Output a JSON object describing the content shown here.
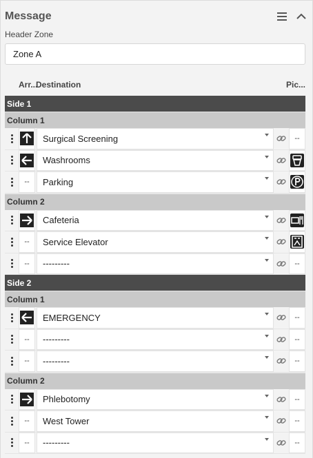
{
  "header": {
    "title": "Message"
  },
  "header_zone": {
    "label": "Header Zone",
    "value": "Zone A"
  },
  "columns": {
    "arrow": "Arr...",
    "destination": "Destination",
    "picto": "Pic..."
  },
  "empty_marker": "--",
  "sides": [
    {
      "label": "Side 1",
      "groups": [
        {
          "label": "Column 1",
          "rows": [
            {
              "arrow": "up",
              "destination": "Surgical Screening",
              "picto": null
            },
            {
              "arrow": "left",
              "destination": "Washrooms",
              "picto": "washroom-icon"
            },
            {
              "arrow": null,
              "destination": "Parking",
              "picto": "parking-icon"
            }
          ]
        },
        {
          "label": "Column 2",
          "rows": [
            {
              "arrow": "right",
              "destination": "Cafeteria",
              "picto": "cafeteria-icon"
            },
            {
              "arrow": null,
              "destination": "Service Elevator",
              "picto": "elevator-icon"
            },
            {
              "arrow": null,
              "destination": "---------",
              "picto": null
            }
          ]
        }
      ]
    },
    {
      "label": "Side 2",
      "groups": [
        {
          "label": "Column 1",
          "rows": [
            {
              "arrow": "left",
              "destination": "EMERGENCY",
              "picto": null
            },
            {
              "arrow": null,
              "destination": "---------",
              "picto": null
            },
            {
              "arrow": null,
              "destination": "---------",
              "picto": null
            }
          ]
        },
        {
          "label": "Column 2",
          "rows": [
            {
              "arrow": "right",
              "destination": "Phlebotomy",
              "picto": null
            },
            {
              "arrow": null,
              "destination": "West Tower",
              "picto": null
            },
            {
              "arrow": null,
              "destination": "---------",
              "picto": null
            }
          ]
        }
      ]
    }
  ]
}
